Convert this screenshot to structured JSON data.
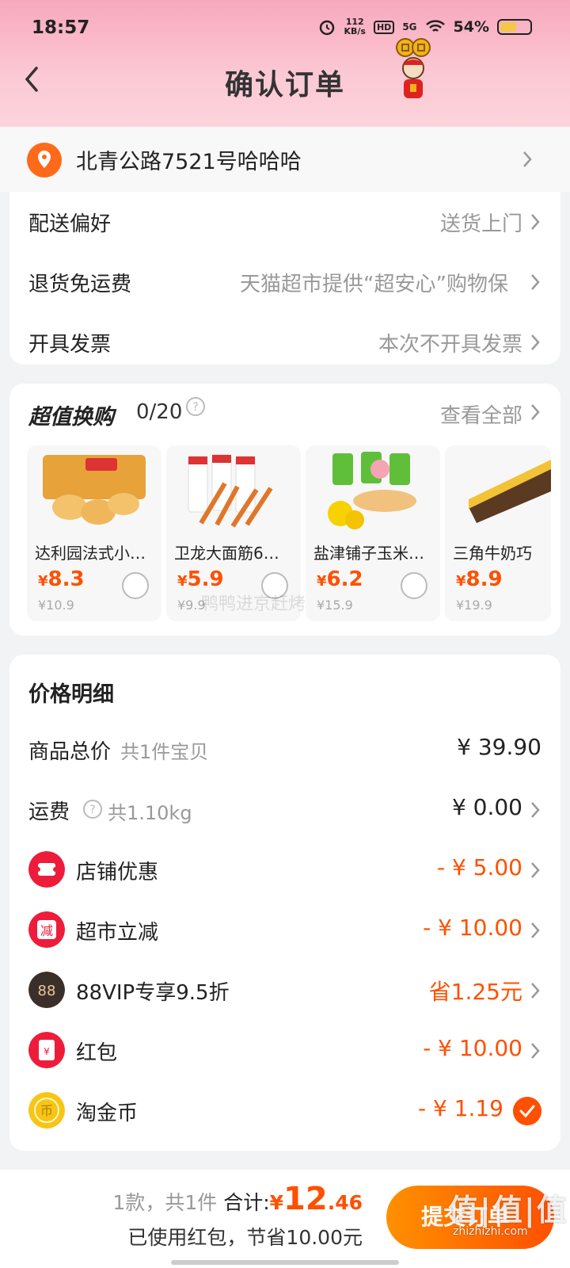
{
  "status": {
    "time": "18:57",
    "net_speed_value": "112",
    "net_speed_unit": "KB/s",
    "hd": "HD",
    "signal": "5G",
    "battery": "54%"
  },
  "header": {
    "title": "确认订单"
  },
  "address": {
    "text": "北青公路7521号哈哈哈"
  },
  "prefs": [
    {
      "label": "配送偏好",
      "value": "送货上门"
    },
    {
      "label": "退货免运费",
      "value": "天猫超市提供“超安心”购物保"
    },
    {
      "label": "开具发票",
      "value": "本次不开具发票"
    }
  ],
  "deals": {
    "title": "超值换购",
    "count": "0/20",
    "view_all": "查看全部",
    "items": [
      {
        "name": "达利园法式小…",
        "price_symbol": "¥",
        "price": "8.3",
        "orig": "¥10.9"
      },
      {
        "name": "卫龙大面筋6…",
        "price_symbol": "¥",
        "price": "5.9",
        "orig": "¥9.9"
      },
      {
        "name": "盐津铺子玉米…",
        "price_symbol": "¥",
        "price": "6.2",
        "orig": "¥15.9"
      },
      {
        "name": "三角牛奶巧",
        "price_symbol": "¥",
        "price": "8.9",
        "orig": "¥19.9"
      }
    ]
  },
  "watermark": "鸭鸭进京赶烤",
  "price_detail": {
    "title": "价格明细",
    "goods_label": "商品总价",
    "goods_sub": "共1件宝贝",
    "goods_value": "¥ 39.90",
    "freight_label": "运费",
    "freight_sub": "共1.10kg",
    "freight_value": "¥ 0.00",
    "discounts": [
      {
        "label": "店铺优惠",
        "value": "- ¥ 5.00",
        "icon": "coupon-icon",
        "color": "#ee1c3b"
      },
      {
        "label": "超市立减",
        "value": "- ¥ 10.00",
        "icon": "reduce-icon",
        "color": "#ee1c3b",
        "icon_text": "减"
      },
      {
        "label": "88VIP专享9.5折",
        "value": "省1.25元",
        "icon": "vip88-icon",
        "color": "#3b2f2a",
        "icon_text": "88"
      },
      {
        "label": "红包",
        "value": "- ¥ 10.00",
        "icon": "red-packet-icon",
        "color": "#ee1c3b",
        "icon_text": "¥"
      },
      {
        "label": "淘金币",
        "value": "- ¥ 1.19",
        "icon": "gold-coin-icon",
        "color": "#f7c516",
        "icon_text": "币"
      }
    ]
  },
  "bottom": {
    "count_text": "1款，共1件",
    "total_label": "合计:",
    "total_symbol": "¥",
    "total_int": "12",
    "total_dec": ".46",
    "saved_text": "已使用红包，节省10.00元",
    "submit": "提交订单",
    "site_watermark": "值|值|值",
    "site_url": "zhizhizhi.com"
  }
}
